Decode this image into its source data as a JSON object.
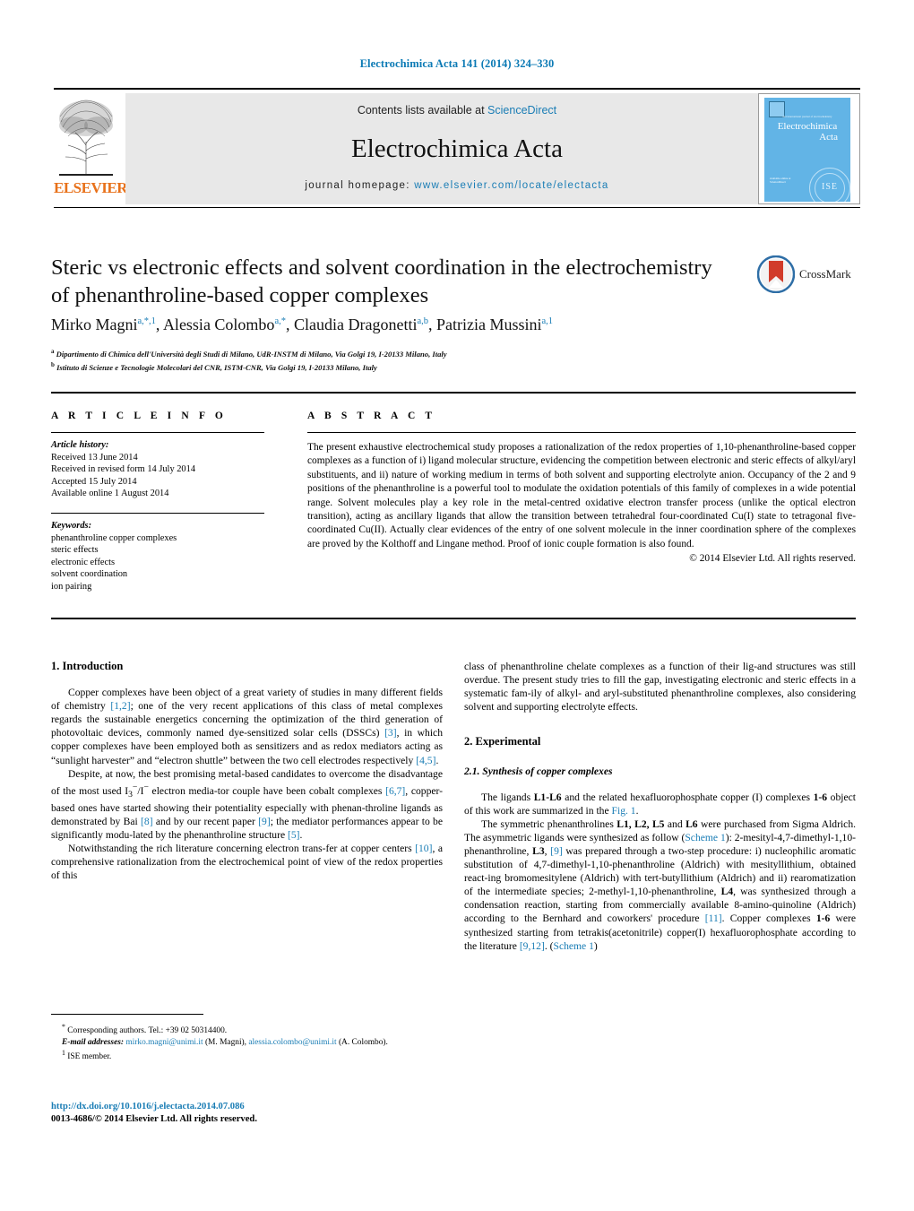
{
  "running_head": "Electrochimica Acta 141 (2014) 324–330",
  "header": {
    "contents_prefix": "Contents lists available at ",
    "sciencedirect": "ScienceDirect",
    "journal_name": "Electrochimica Acta",
    "homepage_label": "journal homepage:",
    "homepage_url": "www.elsevier.com/locate/electacta",
    "publisher_logo_text": "ELSEVIER",
    "cover": {
      "title_line1": "Electrochimica",
      "title_line2": "Acta",
      "tagline": "and international journal of electrochemistry",
      "society_mark": "ISE",
      "corner_note": "available online at\nScienceDirect"
    }
  },
  "article": {
    "title": "Steric vs electronic effects and solvent coordination in the electrochemistry of phenanthroline-based copper complexes",
    "authors": [
      {
        "name": "Mirko Magni",
        "marks": "a,*,1"
      },
      {
        "name": "Alessia Colombo",
        "marks": "a,*"
      },
      {
        "name": "Claudia Dragonetti",
        "marks": "a,b"
      },
      {
        "name": "Patrizia Mussini",
        "marks": "a,1"
      }
    ],
    "affiliations": [
      {
        "mark": "a",
        "text": "Dipartimento di Chimica dell'Università degli Studi di Milano, UdR-INSTM di Milano, Via Golgi 19, I-20133 Milano, Italy"
      },
      {
        "mark": "b",
        "text": "Istituto di Scienze e Tecnologie Molecolari del CNR, ISTM-CNR, Via Golgi 19, I-20133 Milano, Italy"
      }
    ],
    "crossmark_label": "CrossMark"
  },
  "article_info": {
    "heading": "A R T I C L E   I N F O",
    "history_label": "Article history:",
    "history": [
      "Received 13 June 2014",
      "Received in revised form 14 July 2014",
      "Accepted 15 July 2014",
      "Available online 1 August 2014"
    ],
    "keywords_label": "Keywords:",
    "keywords": [
      "phenanthroline copper complexes",
      "steric effects",
      "electronic effects",
      "solvent coordination",
      "ion pairing"
    ]
  },
  "abstract": {
    "heading": "A B S T R A C T",
    "text": "The present exhaustive electrochemical study proposes a rationalization of the redox properties of 1,10-phenanthroline-based copper complexes as a function of i) ligand molecular structure, evidencing the competition between electronic and steric effects of alkyl/aryl substituents, and ii) nature of working medium in terms of both solvent and supporting electrolyte anion. Occupancy of the 2 and 9 positions of the phenanthroline is a powerful tool to modulate the oxidation potentials of this family of complexes in a wide potential range. Solvent molecules play a key role in the metal-centred oxidative electron transfer process (unlike the optical electron transition), acting as ancillary ligands that allow the transition between tetrahedral four-coordinated Cu(I) state to tetragonal five-coordinated Cu(II). Actually clear evidences of the entry of one solvent molecule in the inner coordination sphere of the complexes are proved by the Kolthoff and Lingane method. Proof of ionic couple formation is also found.",
    "copyright": "© 2014 Elsevier Ltd. All rights reserved."
  },
  "body": {
    "intro_heading": "1. Introduction",
    "intro_p1_a": "Copper complexes have been object of a great variety of studies in many different fields of chemistry ",
    "intro_p1_r1": "[1,2]",
    "intro_p1_b": "; one of the very recent applications of this class of metal complexes regards the sustainable energetics concerning the optimization of the third generation of photovoltaic devices, commonly named dye-sensitized solar cells (DSSCs) ",
    "intro_p1_r2": "[3]",
    "intro_p1_c": ", in which copper complexes have been employed both as sensitizers and as redox mediators acting as “sunlight harvester” and “electron shuttle” between the two cell electrodes respectively ",
    "intro_p1_r3": "[4,5]",
    "intro_p1_d": ".",
    "intro_p2_a": "Despite, at now, the best promising metal-based candidates to overcome the disadvantage of the most used I",
    "intro_p2_sub": "3",
    "intro_p2_sup": "−",
    "intro_p2_b": "/I",
    "intro_p2_sup2": "−",
    "intro_p2_c": " electron media-tor couple have been cobalt complexes ",
    "intro_p2_r1": "[6,7]",
    "intro_p2_d": ", copper-based ones have started showing their potentiality especially with phenan-throline ligands as demonstrated by Bai ",
    "intro_p2_r2": "[8]",
    "intro_p2_e": " and by our recent paper ",
    "intro_p2_r3": "[9]",
    "intro_p2_f": "; the mediator performances appear to be significantly modu-lated by the phenanthroline structure ",
    "intro_p2_r4": "[5]",
    "intro_p2_g": ".",
    "intro_p3_a": "Notwithstanding the rich literature concerning electron trans-fer at copper centers ",
    "intro_p3_r1": "[10]",
    "intro_p3_b": ", a comprehensive rationalization from the electrochemical point of view of the redox properties of this",
    "right_p1": "class of phenanthroline chelate complexes as a function of their lig-and structures was still overdue. The present study tries to fill the gap, investigating electronic and steric effects in a systematic fam-ily of alkyl- and aryl-substituted phenanthroline complexes, also considering solvent and supporting electrolyte effects.",
    "exp_heading": "2. Experimental",
    "synth_heading": "2.1. Synthesis of copper complexes",
    "synth_p1_a": "The ligands ",
    "synth_p1_b1": "L1-L6",
    "synth_p1_c": " and the related hexafluorophosphate copper (I) complexes ",
    "synth_p1_b2": "1-6",
    "synth_p1_d": " object of this work are summarized in the ",
    "synth_p1_lnk": "Fig. 1",
    "synth_p1_e": ".",
    "synth_p2_a": "The symmetric phenanthrolines ",
    "synth_p2_b1": "L1, L2, L5",
    "synth_p2_c": " and ",
    "synth_p2_b2": "L6",
    "synth_p2_d": " were purchased from Sigma Aldrich. The asymmetric ligands were synthesized as follow (",
    "synth_p2_lnk": "Scheme 1",
    "synth_p2_e": "): 2-mesityl-4,7-dimethyl-1,10-phenanthroline, ",
    "synth_p2_b3": "L3",
    "synth_p2_f": ", ",
    "synth_p2_r1": "[9]",
    "synth_p2_g": " was prepared through a two-step procedure: i) nucleophilic aromatic substitution of 4,7-dimethyl-1,10-phenanthroline (Aldrich) with mesityllithium, obtained react-ing bromomesitylene (Aldrich) with tert-butyllithium (Aldrich) and ii) rearomatization of the intermediate species; 2-methyl-1,10-phenanthroline, ",
    "synth_p2_b4": "L4",
    "synth_p2_h": ", was synthesized through a condensation reaction, starting from commercially available 8-amino-quinoline (Aldrich) according to the Bernhard and coworkers' procedure ",
    "synth_p2_r2": "[11]",
    "synth_p2_i": ". Copper complexes ",
    "synth_p2_b5": "1-6",
    "synth_p2_j": " were synthesized starting from tetrakis(acetonitrile) copper(I) hexafluorophosphate according to the literature ",
    "synth_p2_r3": "[9,12]",
    "synth_p2_k": ". (",
    "synth_p2_lnk2": "Scheme 1",
    "synth_p2_l": ")"
  },
  "footnotes": {
    "corr_mark": "*",
    "corr_text": "Corresponding authors. Tel.: +39 02 50314400.",
    "email_label": "E-mail addresses:",
    "email1": "mirko.magni@unimi.it",
    "email1_name": "(M. Magni),",
    "email2": "alessia.colombo@unimi.it",
    "email2_name": "(A. Colombo).",
    "note_mark": "1",
    "note_text": "ISE member.",
    "doi_url": "http://dx.doi.org/10.1016/j.electacta.2014.07.086",
    "issn_line": "0013-4686/© 2014 Elsevier Ltd. All rights reserved."
  },
  "colors": {
    "link": "#1a7db5",
    "elsevier_orange": "#e8711a",
    "header_band": "#e8e8e8",
    "cover_blue": "#62b4e6",
    "crossmark_red": "#d13c2b"
  }
}
